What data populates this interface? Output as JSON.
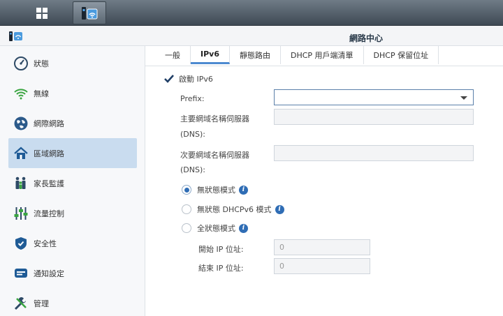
{
  "window": {
    "title": "網路中心"
  },
  "sidebar": {
    "items": [
      {
        "label": "狀態",
        "icon": "gauge-icon"
      },
      {
        "label": "無線",
        "icon": "wifi-icon"
      },
      {
        "label": "網際網路",
        "icon": "globe-icon"
      },
      {
        "label": "區域網路",
        "icon": "home-icon",
        "active": true
      },
      {
        "label": "家長監護",
        "icon": "family-icon"
      },
      {
        "label": "流量控制",
        "icon": "sliders-icon"
      },
      {
        "label": "安全性",
        "icon": "shield-icon"
      },
      {
        "label": "通知設定",
        "icon": "message-icon"
      },
      {
        "label": "管理",
        "icon": "tools-icon"
      }
    ]
  },
  "tabs": [
    "一般",
    "IPv6",
    "靜態路由",
    "DHCP 用戶端清單",
    "DHCP 保留位址"
  ],
  "form": {
    "enable_ipv6": "啟動 IPv6",
    "prefix_label": "Prefix:",
    "prefix_value": "",
    "primary_dns_label": "主要網域名稱伺服器",
    "primary_dns_sub": "(DNS):",
    "secondary_dns_label": "次要網域名稱伺服器",
    "secondary_dns_sub": "(DNS):",
    "mode_stateless": "無狀態模式",
    "mode_stateless_dhcpv6": "無狀態 DHCPv6 模式",
    "mode_stateful": "全狀態模式",
    "start_ip_label": "開始 IP 位址:",
    "start_ip_value": "0",
    "end_ip_label": "結束 IP 位址:",
    "end_ip_value": "0"
  },
  "colors": {
    "accent": "#2f6db5",
    "active_nav": "#c9dcef"
  }
}
